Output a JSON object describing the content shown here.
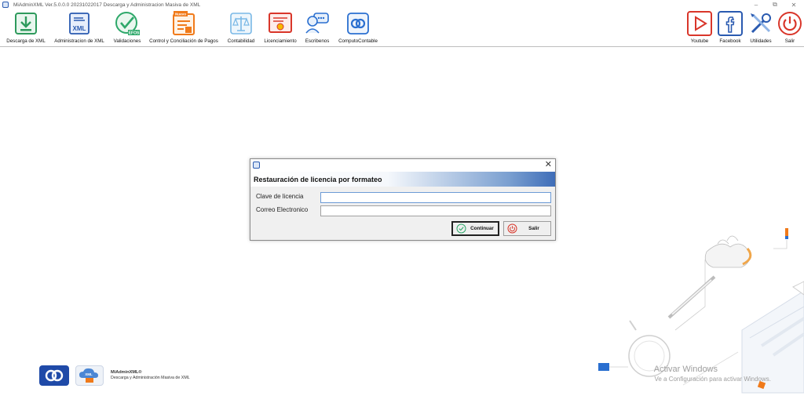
{
  "window": {
    "title": "MiAdminXML Ver.5.0.0.0 20231022017 Descarga y Administracion Masiva de XML",
    "minimize_glyph": "–",
    "restore_glyph": "⧉",
    "close_glyph": "✕"
  },
  "toolbar": {
    "left_items": [
      {
        "label": "Descarga de XML",
        "icon": "download-icon",
        "color": "#2e9a5c"
      },
      {
        "label": "Administracion de XML",
        "icon": "xml-document-icon",
        "color": "#2a5ab0",
        "icon_text": "XML"
      },
      {
        "label": "Validaciones",
        "icon": "check-circle-icon",
        "color": "#2ea86a",
        "icon_text": "EFOS"
      },
      {
        "label": "Control y Conciliación de Pagos",
        "icon": "payments-icon",
        "color": "#f07a1a",
        "badge": "Nuevo"
      },
      {
        "label": "Contabilidad",
        "icon": "balance-scale-icon",
        "color": "#7ab8e6"
      },
      {
        "label": "Licenciamiento",
        "icon": "certificate-icon",
        "color": "#d9362a"
      },
      {
        "label": "Escribenos",
        "icon": "chat-icon",
        "color": "#2a6fd0"
      },
      {
        "label": "ComputoContable",
        "icon": "computo-logo-icon",
        "color": "#2a6fd0"
      }
    ],
    "right_items": [
      {
        "label": "Youtube",
        "icon": "youtube-play-icon",
        "color": "#d9362a"
      },
      {
        "label": "Facebook",
        "icon": "facebook-icon",
        "color": "#2a5ab0"
      },
      {
        "label": "Utilidades",
        "icon": "tools-icon",
        "color": "#2a5ab0"
      },
      {
        "label": "Salir",
        "icon": "power-icon",
        "color": "#d9362a"
      }
    ]
  },
  "dialog": {
    "header": "Restauración de licencia por formateo",
    "license_label": "Clave de licencia",
    "license_value": "",
    "email_label": "Correo Electronico",
    "email_value": "",
    "continue_label": "Continuar",
    "exit_label": "Salir",
    "close_glyph": "✕"
  },
  "footer": {
    "brand_name": "MiAdminXML®",
    "brand_tagline": "Descarga y Administración Masiva de XML",
    "logo_badge": "XML"
  },
  "watermark": {
    "line1": "Activar Windows",
    "line2": "Ve a Configuración para activar Windows."
  }
}
